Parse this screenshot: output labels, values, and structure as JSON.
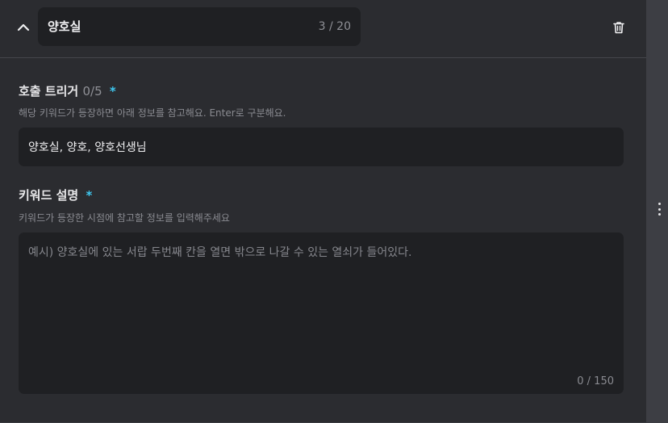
{
  "header": {
    "title_value": "양호실",
    "title_counter": "3 / 20",
    "collapse_icon": "chevron-up-icon",
    "delete_icon": "trash-icon"
  },
  "trigger": {
    "label": "호출 트리거",
    "count": "0/5",
    "required_mark": "*",
    "help": "해당 키워드가 등장하면 아래 정보를 참고해요. Enter로 구분해요.",
    "value": "양호실, 양호, 양호선생님"
  },
  "description": {
    "label": "키워드 설명",
    "required_mark": "*",
    "help": "키워드가 등장한 시점에 참고할 정보를 입력해주세요",
    "placeholder": "예시) 양호실에 있는 서랍 두번째 칸을 열면 밖으로 나갈 수 있는 열쇠가 들어있다.",
    "counter": "0 / 150"
  },
  "sidebar": {
    "more_icon": "kebab-vertical-icon"
  },
  "colors": {
    "panel_bg": "#2b2c30",
    "field_bg": "#1f2023",
    "accent_required": "#3fc8f0",
    "scrollbar_bg": "#3d3e44"
  }
}
